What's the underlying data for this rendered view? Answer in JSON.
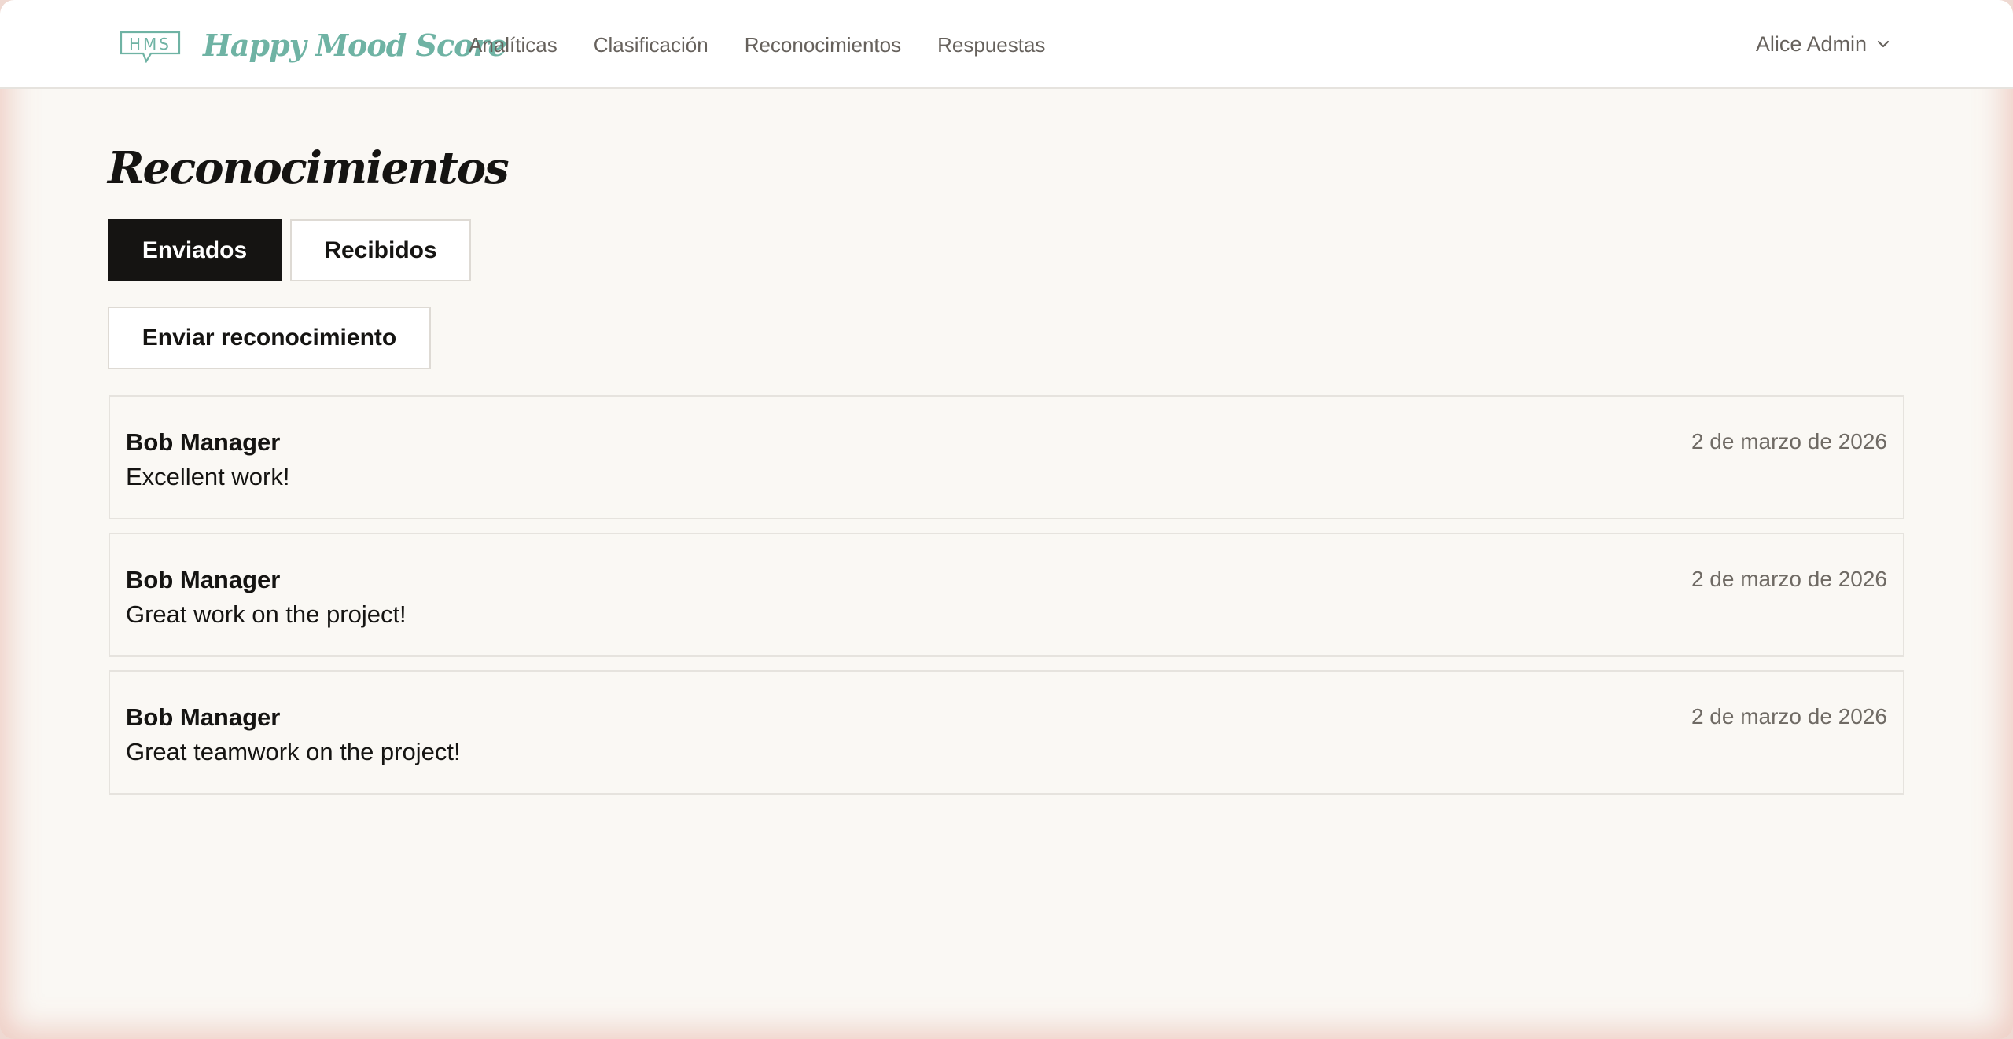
{
  "header": {
    "logo_text": "HMS",
    "brand": "Happy Mood Score",
    "nav": [
      {
        "label": "Analíticas"
      },
      {
        "label": "Clasificación"
      },
      {
        "label": "Reconocimientos"
      },
      {
        "label": "Respuestas"
      }
    ],
    "user": "Alice Admin"
  },
  "main": {
    "title": "Reconocimientos",
    "tabs": [
      {
        "label": "Enviados",
        "active": true
      },
      {
        "label": "Recibidos",
        "active": false
      }
    ],
    "send_button": "Enviar reconocimiento",
    "recognitions": [
      {
        "name": "Bob Manager",
        "message": "Excellent work!",
        "date": "2 de marzo de 2026"
      },
      {
        "name": "Bob Manager",
        "message": "Great work on the project!",
        "date": "2 de marzo de 2026"
      },
      {
        "name": "Bob Manager",
        "message": "Great teamwork on the project!",
        "date": "2 de marzo de 2026"
      }
    ]
  },
  "colors": {
    "brand": "#6fb3a4",
    "text": "#151412",
    "muted": "#66615c",
    "background": "#faf8f4"
  }
}
